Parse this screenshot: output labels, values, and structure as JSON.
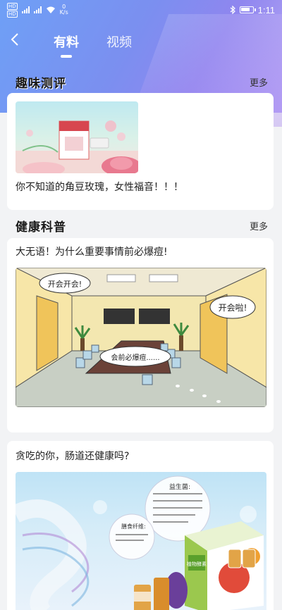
{
  "status_bar": {
    "time": "1:11",
    "speed_value": "0",
    "speed_unit": "K/s",
    "hd1": "HD",
    "hd2": "HD"
  },
  "nav": {
    "tabs": [
      {
        "label": "有料",
        "active": true
      },
      {
        "label": "视频",
        "active": false
      }
    ]
  },
  "sections": [
    {
      "title": "趣味测评",
      "more": "更多",
      "cards": [
        {
          "caption": "你不知道的角豆玫瑰，女性福音！！！"
        }
      ]
    },
    {
      "title": "健康科普",
      "more": "更多",
      "cards": [
        {
          "title": "大无语！为什么重要事情前必爆痘!",
          "bubbles": [
            "开会开会!",
            "开会啦!",
            "会前必爆痘......"
          ]
        },
        {
          "title": "贪吃的你，肠道还健康吗?",
          "bubbles": [
            "益生菌:",
            "膳食纤维:"
          ],
          "product_label": "植物酵素"
        }
      ]
    }
  ],
  "colors": {
    "header_start": "#6ea0f6",
    "header_end": "#b9a9f5",
    "page_bg": "#f2f3f5"
  }
}
